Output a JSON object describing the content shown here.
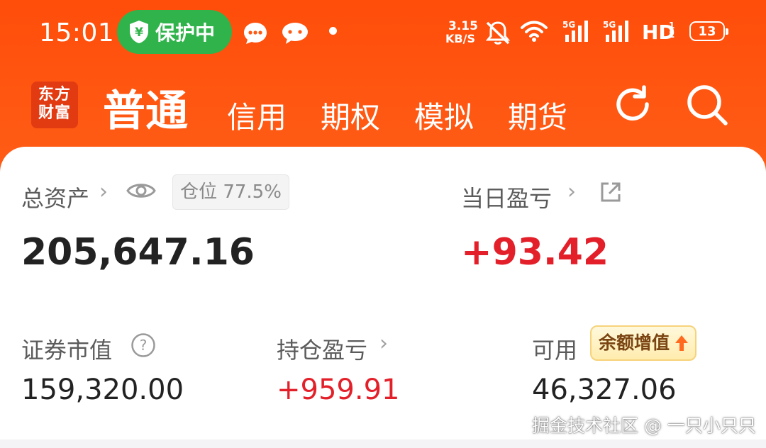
{
  "status_bar": {
    "time": "15:01",
    "protect": "保护中",
    "net_speed_top": "3.15",
    "net_speed_bottom": "KB/S",
    "hd": "HD",
    "battery": "13"
  },
  "header": {
    "logo_line1": "东方",
    "logo_line2": "财富",
    "tabs": [
      "普通",
      "信用",
      "期权",
      "模拟",
      "期货"
    ]
  },
  "assets": {
    "total_label": "总资产",
    "position_badge": "仓位  77.5%",
    "total_value": "205,647.16",
    "daily_pl_label": "当日盈亏",
    "daily_pl_value": "+93.42",
    "market_value_label": "证券市值",
    "market_value": "159,320.00",
    "holding_pl_label": "持仓盈亏",
    "holding_pl_value": "+959.91",
    "available_label": "可用",
    "balance_badge": "余额增值",
    "available_value": "46,327.06"
  },
  "watermark": "掘金技术社区 @ 一只小只只",
  "colors": {
    "brand_orange": "#ff5a14",
    "profit_red": "#e3202a",
    "protect_green": "#2fb34a"
  },
  "icons": [
    "shield-yen-icon",
    "chat-bubble-icon",
    "wechat-icon",
    "bell-off-icon",
    "wifi-icon",
    "signal-icon",
    "refresh-icon",
    "search-icon",
    "eye-icon",
    "share-icon",
    "help-icon"
  ]
}
